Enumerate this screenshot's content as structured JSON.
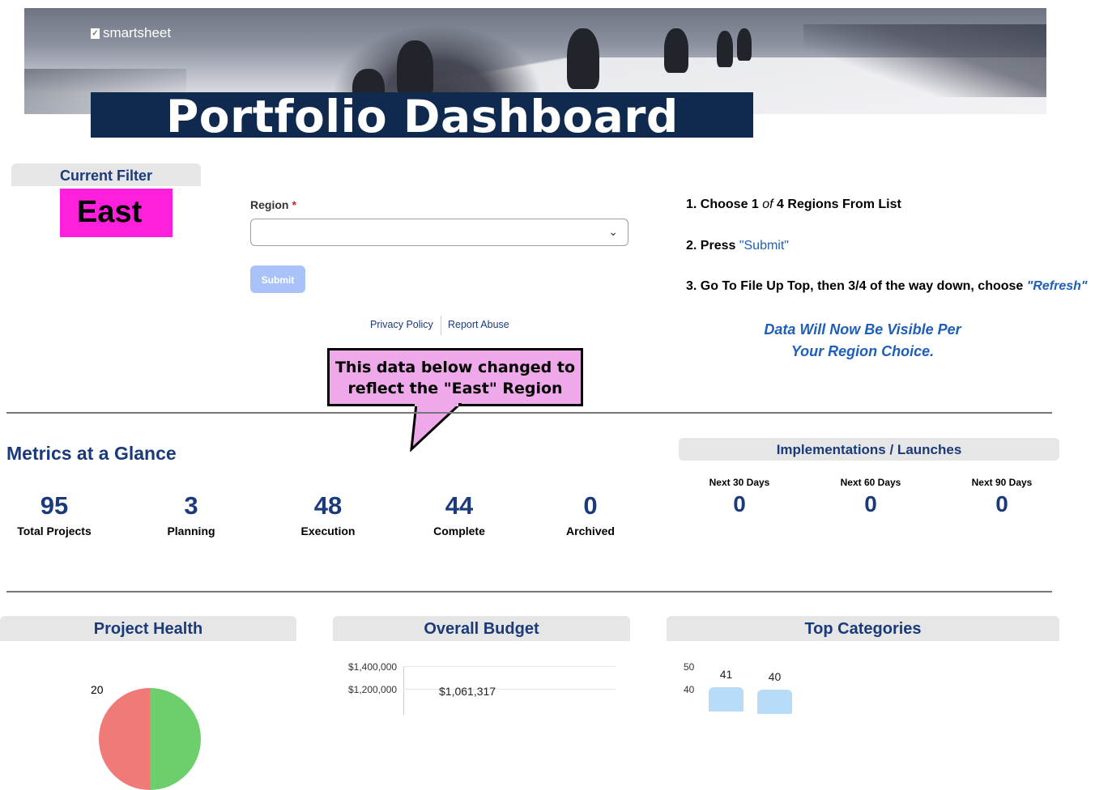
{
  "banner": {
    "brand": "smartsheet",
    "title": "Portfolio Dashboard"
  },
  "current_filter": {
    "heading": "Current Filter",
    "value": "East"
  },
  "form": {
    "region_label": "Region",
    "required_mark": "*",
    "region_value": "",
    "submit_label": "Submit",
    "privacy_link": "Privacy Policy",
    "abuse_link": "Report Abuse"
  },
  "instructions": {
    "step1_prefix": "1.  Choose 1 ",
    "step1_of": "of",
    "step1_suffix": " 4 Regions From List",
    "step2_prefix": "2.  Press ",
    "step2_link": "\"Submit\"",
    "step3_prefix": "3.  Go To File Up Top, then 3/4 of the way down, choose ",
    "step3_link": "\"Refresh\"",
    "note_line1": "Data Will Now Be Visible Per",
    "note_line2": "Your Region Choice."
  },
  "callout": {
    "line1": "This data below changed to",
    "line2": "reflect the \"East\" Region"
  },
  "metrics": {
    "title": "Metrics at a Glance",
    "items": [
      {
        "value": "95",
        "label": "Total Projects"
      },
      {
        "value": "3",
        "label": "Planning"
      },
      {
        "value": "48",
        "label": "Execution"
      },
      {
        "value": "44",
        "label": "Complete"
      },
      {
        "value": "0",
        "label": "Archived"
      }
    ]
  },
  "implementations": {
    "title": "Implementations / Launches",
    "items": [
      {
        "label": "Next 30 Days",
        "value": "0"
      },
      {
        "label": "Next 60 Days",
        "value": "0"
      },
      {
        "label": "Next 90 Days",
        "value": "0"
      }
    ]
  },
  "panels": {
    "health": "Project Health",
    "budget": "Overall Budget",
    "categories": "Top Categories"
  },
  "health_chart": {
    "label": "20"
  },
  "budget_chart": {
    "ticks": [
      "$1,400,000",
      "$1,200,000"
    ],
    "value_label": "$1,061,317"
  },
  "categories_chart": {
    "ticks": [
      "50",
      "40"
    ],
    "values": [
      "41",
      "40"
    ]
  },
  "colors": {
    "navy": "#0f2a4e",
    "accent_blue": "#1a3a7a",
    "filter_magenta": "#ff1fdc",
    "callout_pink": "#efa8e9",
    "submit_disabled": "#a9c2f7"
  }
}
